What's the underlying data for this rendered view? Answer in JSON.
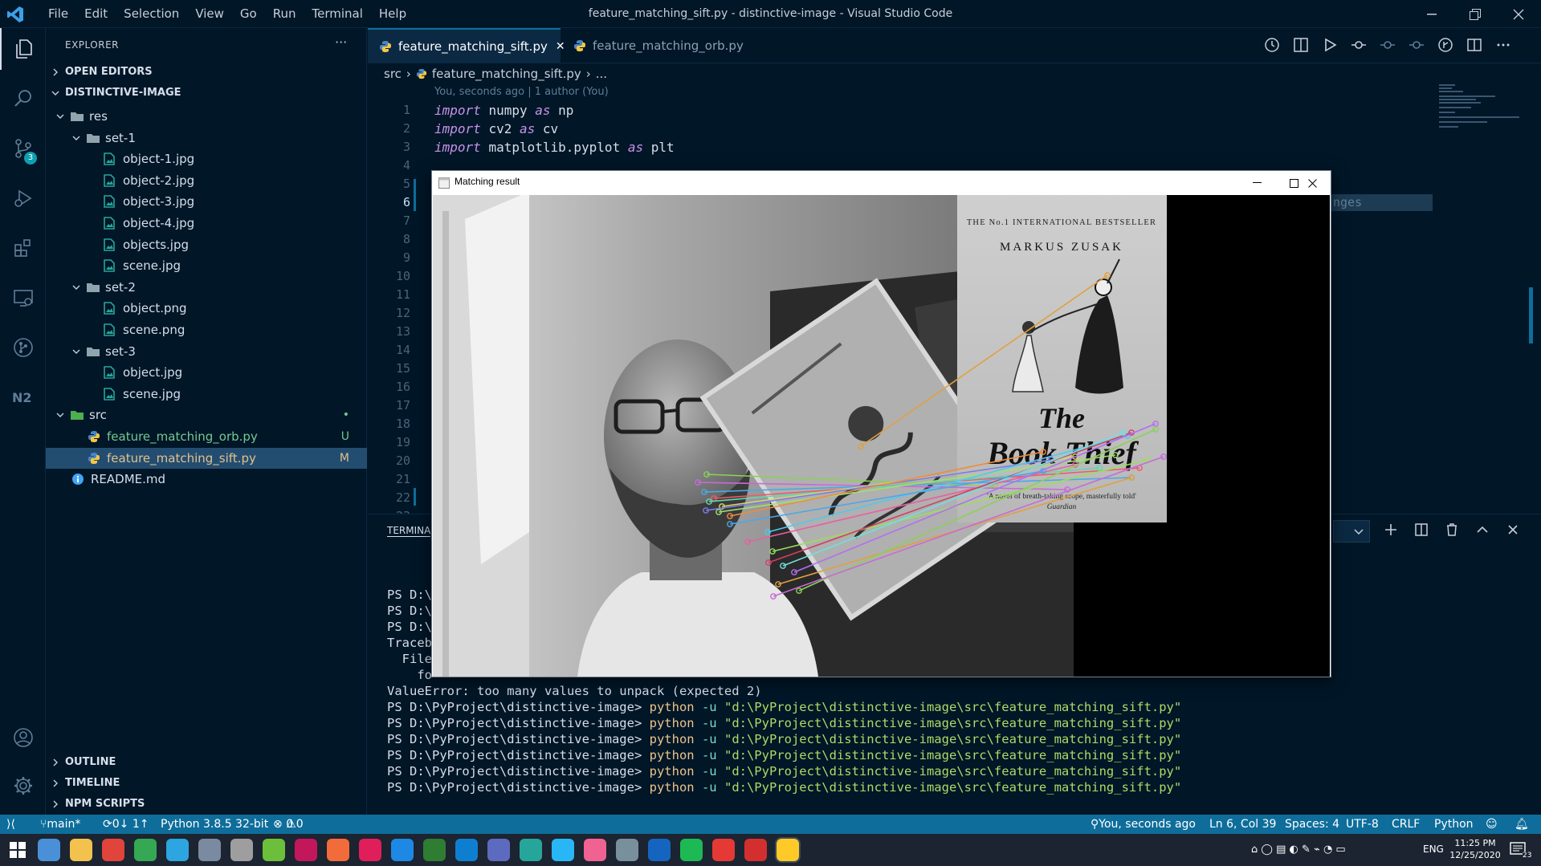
{
  "window": {
    "title": "feature_matching_sift.py - distinctive-image - Visual Studio Code",
    "menu": [
      "File",
      "Edit",
      "Selection",
      "View",
      "Go",
      "Run",
      "Terminal",
      "Help"
    ]
  },
  "activity_bar": {
    "items": [
      "explorer-icon",
      "search-icon",
      "source-control-icon",
      "run-debug-icon",
      "extensions-icon",
      "remote-explorer-icon",
      "git-graph-icon",
      "n2-icon"
    ],
    "source_control_badge": "3"
  },
  "sidebar": {
    "title": "EXPLORER",
    "more": "···",
    "open_editors": "OPEN EDITORS",
    "workspace": "DISTINCTIVE-IMAGE",
    "tree": [
      {
        "label": "res",
        "type": "folder",
        "depth": 1
      },
      {
        "label": "set-1",
        "type": "folder",
        "depth": 2
      },
      {
        "label": "object-1.jpg",
        "type": "image",
        "depth": 3
      },
      {
        "label": "object-2.jpg",
        "type": "image",
        "depth": 3
      },
      {
        "label": "object-3.jpg",
        "type": "image",
        "depth": 3
      },
      {
        "label": "object-4.jpg",
        "type": "image",
        "depth": 3
      },
      {
        "label": "objects.jpg",
        "type": "image",
        "depth": 3
      },
      {
        "label": "scene.jpg",
        "type": "image",
        "depth": 3
      },
      {
        "label": "set-2",
        "type": "folder",
        "depth": 2
      },
      {
        "label": "object.png",
        "type": "image",
        "depth": 3
      },
      {
        "label": "scene.png",
        "type": "image",
        "depth": 3
      },
      {
        "label": "set-3",
        "type": "folder",
        "depth": 2
      },
      {
        "label": "object.jpg",
        "type": "image",
        "depth": 3
      },
      {
        "label": "scene.jpg",
        "type": "image",
        "depth": 3
      },
      {
        "label": "src",
        "type": "folder-src",
        "depth": 1,
        "status": "•"
      },
      {
        "label": "feature_matching_orb.py",
        "type": "python",
        "depth": 2,
        "status": "U"
      },
      {
        "label": "feature_matching_sift.py",
        "type": "python",
        "depth": 2,
        "status": "M",
        "selected": true
      },
      {
        "label": "README.md",
        "type": "info",
        "depth": 1
      }
    ],
    "outline": "OUTLINE",
    "timeline": "TIMELINE",
    "npm_scripts": "NPM SCRIPTS"
  },
  "tabs": [
    {
      "label": "feature_matching_sift.py",
      "active": true,
      "close": "✕"
    },
    {
      "label": "feature_matching_orb.py",
      "active": false
    }
  ],
  "breadcrumb": {
    "folder": "src",
    "file": "feature_matching_sift.py",
    "rest": "..."
  },
  "editor": {
    "codelens": "You, seconds ago | 1 author (You)",
    "line_numbers": [
      "1",
      "2",
      "3",
      "4",
      "5",
      "6",
      "7",
      "8",
      "9",
      "10",
      "11",
      "12",
      "13",
      "14",
      "15",
      "16",
      "17",
      "18",
      "19",
      "20",
      "21",
      "22",
      "23"
    ],
    "lines": [
      {
        "kw1": "import",
        "mod": "numpy",
        "kw2": "as",
        "alias": "np"
      },
      {
        "kw1": "import",
        "mod": "cv2",
        "kw2": "as",
        "alias": "cv"
      },
      {
        "kw1": "import",
        "mod": "matplotlib.pyplot",
        "kw2": "as",
        "alias": "plt"
      }
    ],
    "peek_text": "nges"
  },
  "panel": {
    "tab": "TERMINA",
    "terminal_lines_partial": [
      "PS D:\\",
      "PS D:\\",
      "PS D:\\",
      "Traceb",
      "  File",
      "    fo"
    ],
    "error_line": "ValueError: too many values to unpack (expected 2)",
    "prompt": "PS D:\\PyProject\\distinctive-image>",
    "command": "python",
    "flag": "-u",
    "script_path": "\"d:\\PyProject\\distinctive-image\\src\\feature_matching_sift.py\"",
    "repeat_count_label": "6"
  },
  "match_window": {
    "title": "Matching result",
    "book_header": "THE No.1 INTERNATIONAL BESTSELLER",
    "book_author": "MARKUS ZUSAK",
    "book_title_1": "The",
    "book_title_2": "Book Thief",
    "book_tagline": "'A novel of breath-taking scope, masterfully told'",
    "book_source": "Guardian",
    "match_line_colors": [
      "#e0a040",
      "#8bd05a",
      "#c86ad8",
      "#4aa8e8",
      "#f05a6a",
      "#60d8b0",
      "#d8d860",
      "#7a7af0",
      "#a0e070",
      "#f08c3c",
      "#50c8f0",
      "#e860a0",
      "#9adf5a",
      "#d04060",
      "#70e0e0",
      "#b070f0"
    ]
  },
  "statusbar": {
    "branch": "main*",
    "sync": "0↓ 1↑",
    "python": "Python 3.8.5 32-bit",
    "problems": "0",
    "warnings": "0",
    "blame": "You, seconds ago",
    "position": "Ln 6, Col 39",
    "spaces": "Spaces: 4",
    "encoding": "UTF-8",
    "eol": "CRLF",
    "language": "Python"
  },
  "taskbar": {
    "lang": "ENG",
    "time": "11:25 PM",
    "date": "12/25/2020",
    "notif_count": "23"
  },
  "colors": {
    "background": "#011627",
    "statusbar": "#0e6d9b",
    "keyword": "#c792ea",
    "string": "#addb67",
    "selection": "#234d70"
  }
}
